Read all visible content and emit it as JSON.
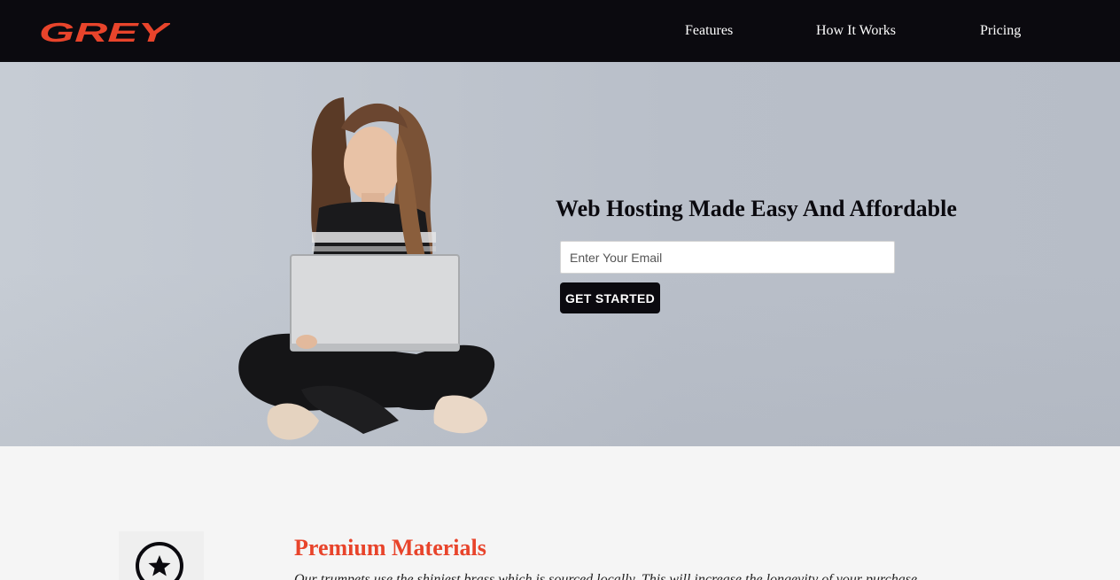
{
  "header": {
    "logo_text": "GREY",
    "nav": [
      {
        "label": "Features"
      },
      {
        "label": "How It Works"
      },
      {
        "label": "Pricing"
      }
    ]
  },
  "hero": {
    "title": "Web Hosting Made Easy And Affordable",
    "email_placeholder": "Enter Your Email",
    "cta_label": "GET STARTED"
  },
  "features": {
    "items": [
      {
        "icon": "star-icon",
        "title": "Premium Materials",
        "text": "Our trumpets use the shiniest brass which is sourced locally. This will increase the longevity of your purchase."
      }
    ]
  },
  "colors": {
    "header_bg": "#0b0a0f",
    "accent": "#e8442b",
    "button_bg": "#0b0a0f"
  }
}
